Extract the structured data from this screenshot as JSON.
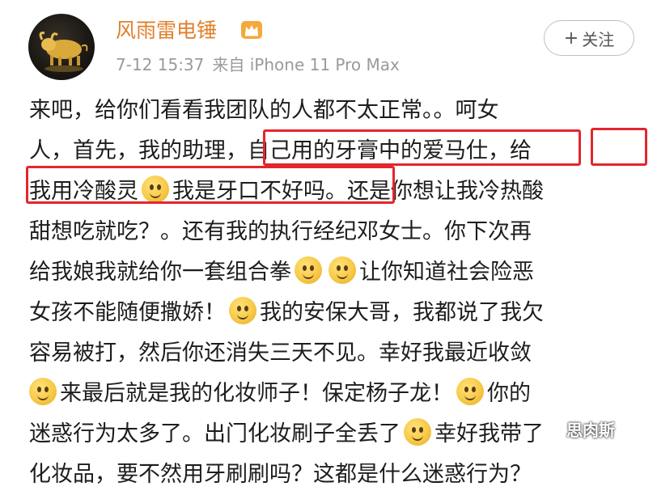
{
  "post": {
    "username": "风雨雷电锤",
    "timestamp": "7-12 15:37",
    "source": "来自 iPhone 11 Pro Max",
    "follow_label": "关注",
    "follow_plus": "+",
    "icons": {
      "avatar": "golden-bull-avatar",
      "vip": "crown-icon",
      "emoji": "smile-emoji-icon"
    },
    "lines": [
      [
        "来吧，给你们看看我团队的人都不太正常。。呵女"
      ],
      [
        "人，首先，我的助理，自己用的牙膏中的爱马仕，给"
      ],
      [
        "我用冷酸灵",
        "我是牙口不好吗。还是你想让我冷热酸"
      ],
      [
        "甜想吃就吃？。还有我的执行经纪邓女士。你下次再"
      ],
      [
        "给我娘我就给你一套组合拳",
        "",
        "让你知道社会险恶"
      ],
      [
        "女孩不能随便撒娇！",
        "我的安保大哥，我都说了我欠"
      ],
      [
        "容易被打，然后你还消失三天不见。幸好我最近收敛"
      ],
      [
        "",
        "来最后就是我的化妆师子！保定杨子龙！",
        "你的"
      ],
      [
        "迷惑行为太多了。出门化妆刷子全丢了",
        "幸好我带了"
      ],
      [
        "化妆品，要不然用牙刷刷吗？这都是什么迷惑行为？"
      ]
    ]
  },
  "watermark": "思肉斯",
  "colors": {
    "username": "#e0802c",
    "highlight_box": "#e3262d",
    "meta": "#9a9a9a"
  }
}
